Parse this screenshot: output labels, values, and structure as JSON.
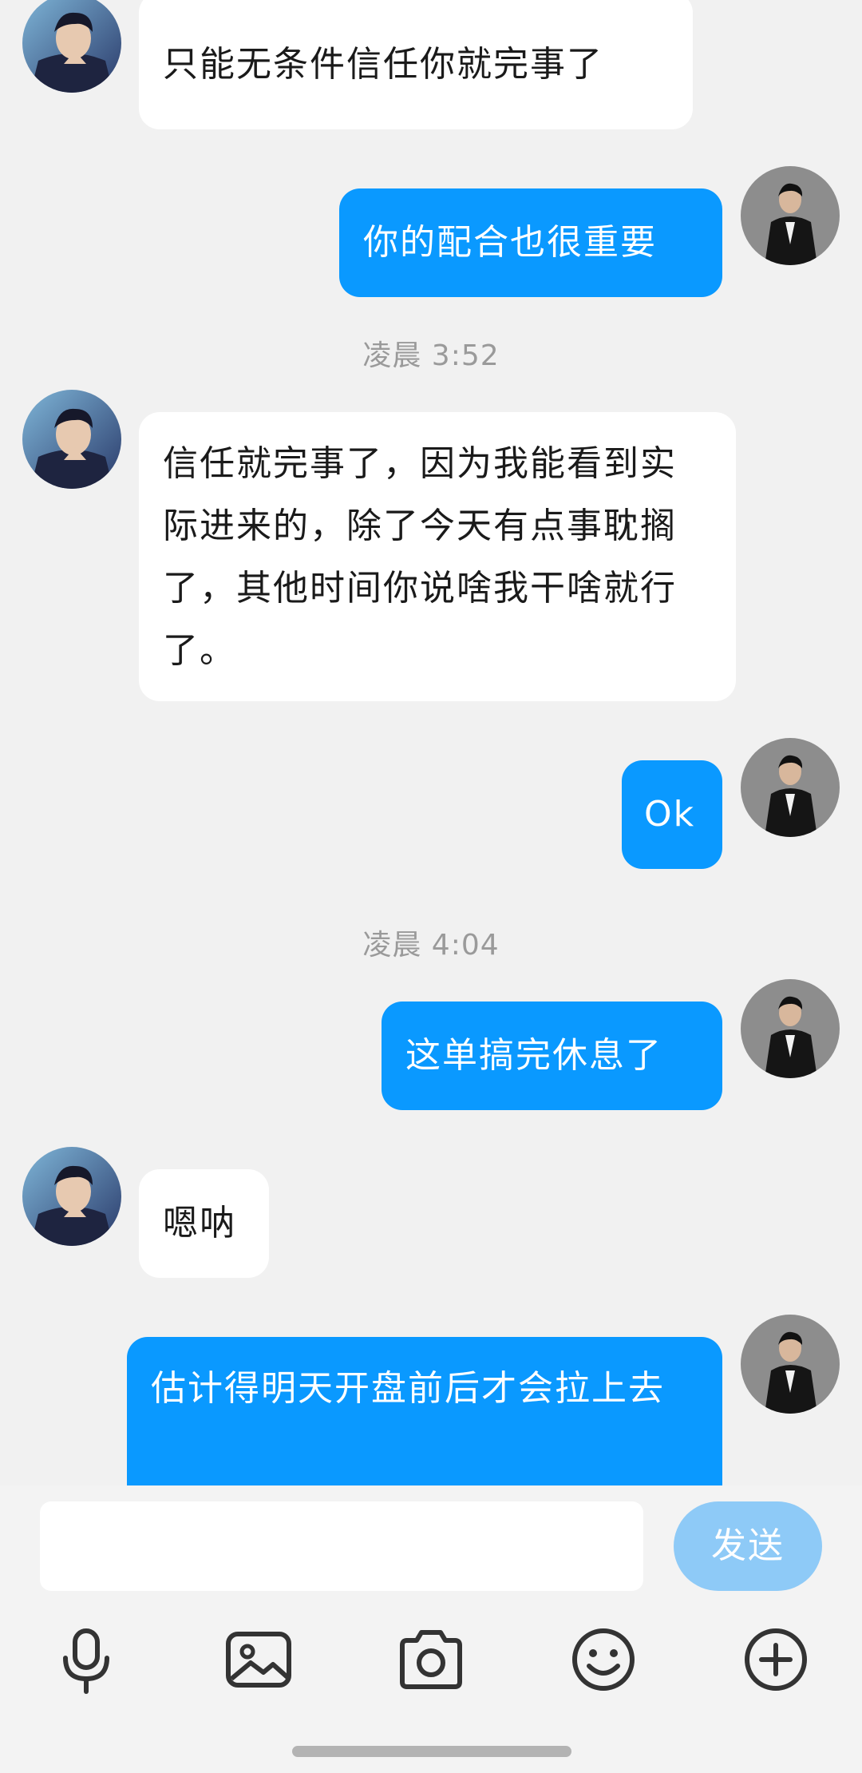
{
  "messages": [
    {
      "side": "in",
      "text": "只能无条件信任你就完事了"
    },
    {
      "side": "out",
      "text": "你的配合也很重要"
    },
    {
      "type": "time",
      "text": "凌晨 3:52"
    },
    {
      "side": "in",
      "text": "信任就完事了，因为我能看到实际进来的，除了今天有点事耽搁了，其他时间你说啥我干啥就行了。"
    },
    {
      "side": "out",
      "text": "Ok"
    },
    {
      "type": "time",
      "text": "凌晨 4:04"
    },
    {
      "side": "out",
      "text": "这单搞完休息了"
    },
    {
      "side": "in",
      "text": "嗯呐"
    },
    {
      "side": "out",
      "text": "估计得明天开盘前后才会拉上去"
    }
  ],
  "composer": {
    "input_value": "",
    "send_label": "发送"
  },
  "toolbar": {
    "icons": [
      "microphone-icon",
      "image-icon",
      "camera-icon",
      "emoji-icon",
      "plus-icon"
    ]
  },
  "colors": {
    "outgoing_bubble": "#0a99ff",
    "incoming_bubble": "#ffffff",
    "background": "#f1f1f1",
    "send_button": "#8ecaf7"
  }
}
